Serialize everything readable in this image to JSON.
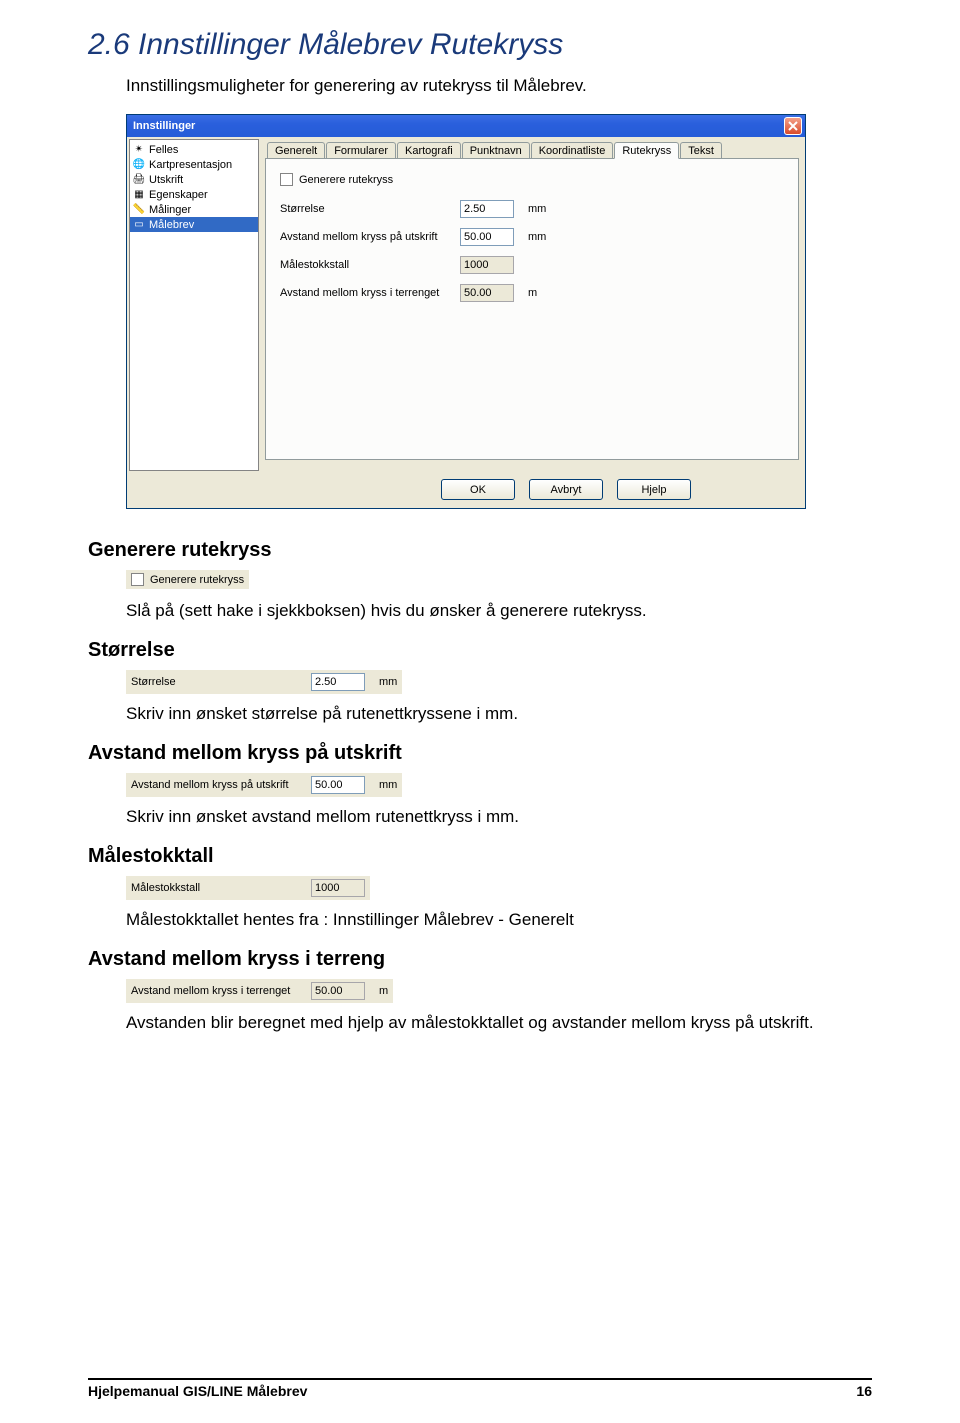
{
  "heading_main": "2.6 Innstillinger Målebrev Rutekryss",
  "intro": "Innstillingsmuligheter for generering av rutekryss til Målebrev.",
  "dialog": {
    "title": "Innstillinger",
    "sidebar": {
      "items": [
        {
          "label": "Felles"
        },
        {
          "label": "Kartpresentasjon"
        },
        {
          "label": "Utskrift"
        },
        {
          "label": "Egenskaper"
        },
        {
          "label": "Målinger"
        },
        {
          "label": "Målebrev",
          "selected": true
        }
      ]
    },
    "tabs": {
      "items": [
        {
          "label": "Generelt"
        },
        {
          "label": "Formularer"
        },
        {
          "label": "Kartografi"
        },
        {
          "label": "Punktnavn"
        },
        {
          "label": "Koordinatliste"
        },
        {
          "label": "Rutekryss",
          "active": true
        },
        {
          "label": "Tekst"
        }
      ]
    },
    "fields": {
      "generate_checkbox_label": "Generere rutekryss",
      "size_label": "Størrelse",
      "size_value": "2.50",
      "size_unit": "mm",
      "dist_print_label": "Avstand mellom kryss på utskrift",
      "dist_print_value": "50.00",
      "dist_print_unit": "mm",
      "scale_label": "Målestokkstall",
      "scale_value": "1000",
      "dist_terrain_label": "Avstand mellom kryss i terrenget",
      "dist_terrain_value": "50.00",
      "dist_terrain_unit": "m"
    },
    "buttons": {
      "ok": "OK",
      "cancel": "Avbryt",
      "help": "Hjelp"
    }
  },
  "sections": {
    "s1": {
      "heading": "Generere rutekryss",
      "snippet_label": "Generere rutekryss",
      "text": "Slå på (sett hake i sjekkboksen) hvis du ønsker å generere rutekryss."
    },
    "s2": {
      "heading": "Størrelse",
      "snippet_label": "Størrelse",
      "snippet_value": "2.50",
      "snippet_unit": "mm",
      "text": "Skriv inn ønsket størrelse på rutenettkryssene i mm."
    },
    "s3": {
      "heading": "Avstand mellom kryss på utskrift",
      "snippet_label": "Avstand mellom kryss på utskrift",
      "snippet_value": "50.00",
      "snippet_unit": "mm",
      "text": "Skriv inn ønsket avstand mellom rutenettkryss i mm."
    },
    "s4": {
      "heading": "Målestokktall",
      "snippet_label": "Målestokkstall",
      "snippet_value": "1000",
      "text": "Målestokktallet hentes fra : Innstillinger Målebrev - Generelt"
    },
    "s5": {
      "heading": "Avstand mellom kryss i terreng",
      "snippet_label": "Avstand mellom kryss i terrenget",
      "snippet_value": "50.00",
      "snippet_unit": "m",
      "text": "Avstanden blir beregnet med hjelp av målestokktallet og avstander mellom kryss på utskrift."
    }
  },
  "footer": {
    "left": "Hjelpemanual GIS/LINE Målebrev",
    "right": "16"
  }
}
